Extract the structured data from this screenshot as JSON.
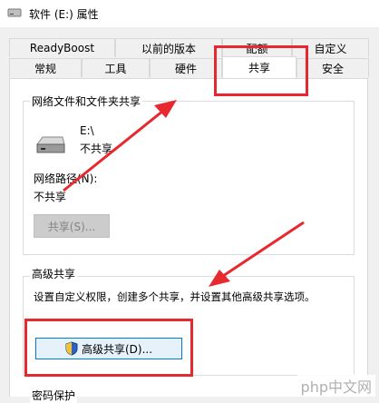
{
  "window": {
    "title": "软件 (E:) 属性",
    "icon": "drive-icon"
  },
  "tabs": {
    "row1": [
      {
        "label": "ReadyBoost"
      },
      {
        "label": "以前的版本"
      },
      {
        "label": "配额"
      },
      {
        "label": "自定义"
      }
    ],
    "row2": [
      {
        "label": "常规"
      },
      {
        "label": "工具"
      },
      {
        "label": "硬件"
      },
      {
        "label": "共享",
        "active": true
      },
      {
        "label": "安全"
      }
    ]
  },
  "network_sharing": {
    "group_title": "网络文件和文件夹共享",
    "drive_label": "E:\\",
    "share_status": "不共享",
    "path_label": "网络路径(N):",
    "path_value": "不共享",
    "share_button": "共享(S)...",
    "drive_icon": "hard-drive-icon"
  },
  "advanced_sharing": {
    "group_title": "高级共享",
    "description": "设置自定义权限，创建多个共享，并设置其他高级共享选项。",
    "button": "高级共享(D)...",
    "button_icon": "uac-shield-icon"
  },
  "password_section": {
    "title": "密码保护"
  },
  "annotations": {
    "accent": "#e8282f"
  },
  "watermark": {
    "text": "php中文网"
  }
}
